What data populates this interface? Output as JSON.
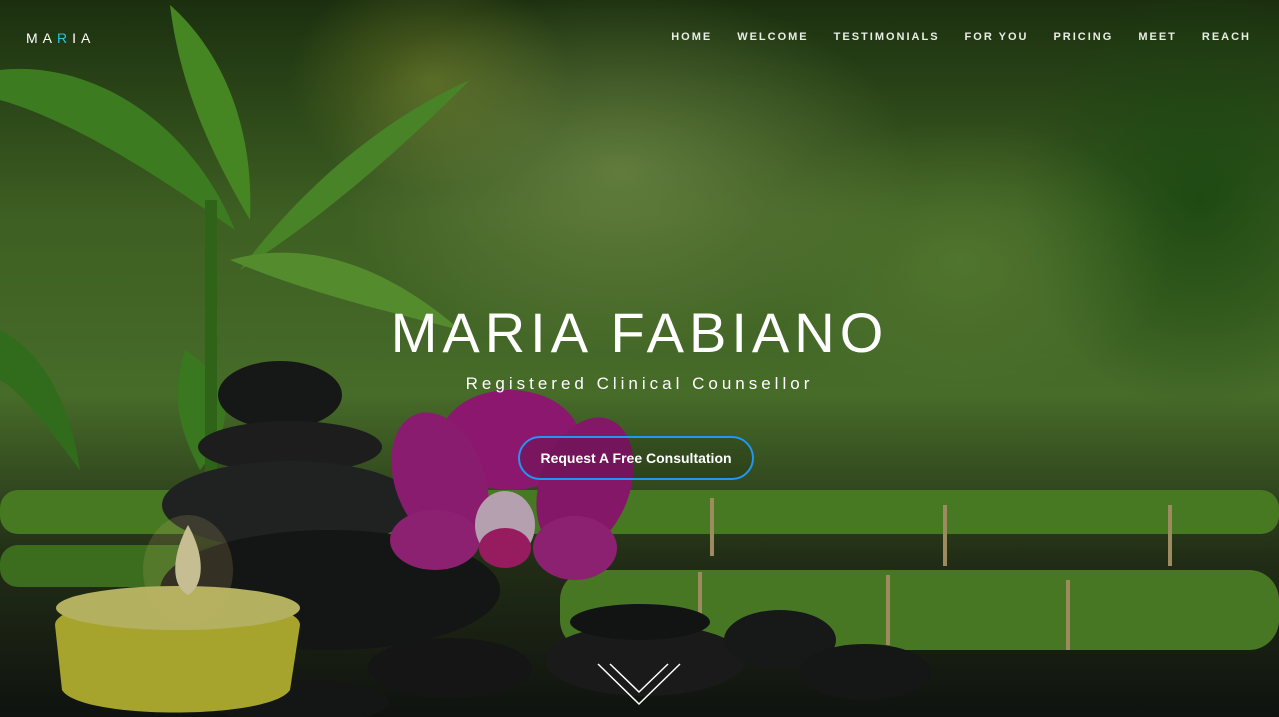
{
  "brand": {
    "parts": [
      "MA",
      "R",
      "I",
      "A"
    ],
    "accent_color": "#2ec4d6"
  },
  "nav": {
    "items": [
      {
        "label": "HOME"
      },
      {
        "label": "WELCOME"
      },
      {
        "label": "TESTIMONIALS"
      },
      {
        "label": "FOR YOU"
      },
      {
        "label": "PRICING"
      },
      {
        "label": "MEET"
      },
      {
        "label": "REACH"
      }
    ]
  },
  "hero": {
    "title": "MARIA FABIANO",
    "subtitle": "Registered Clinical Counsellor",
    "cta_label": "Request A Free Consultation",
    "cta_border_color": "#2196f3",
    "scroll_icon": "chevron-down-icon"
  }
}
